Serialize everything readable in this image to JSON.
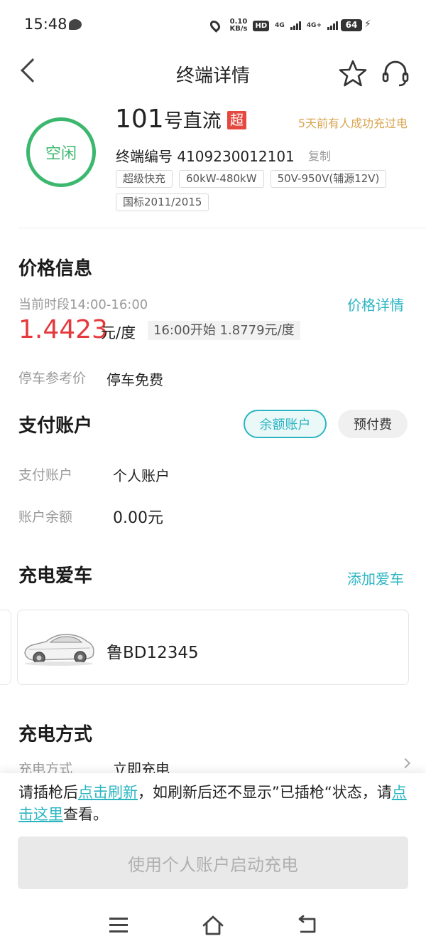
{
  "status_bar": {
    "time": "15:48",
    "speed_value": "0.10",
    "speed_unit": "KB/s",
    "hd_label": "HD",
    "net1": "4G",
    "net2": "4G+",
    "battery": "64"
  },
  "header": {
    "title": "终端详情"
  },
  "terminal": {
    "status": "空闲",
    "name_number": "101",
    "name_suffix": "号直流",
    "super_badge": "超",
    "last_charge_note": "5天前有人成功充过电",
    "terminal_no_label": "终端编号 4109230012101",
    "copy_label": "复制",
    "tags": [
      "超级快充",
      "60kW-480kW",
      "50V-950V(辅源12V)",
      "国标2011/2015"
    ]
  },
  "price": {
    "section_title": "价格信息",
    "detail_link": "价格详情",
    "current_period": "当前时段14:00-16:00",
    "current_price": "1.4423",
    "unit": "元/度",
    "next_price": "16:00开始  1.8779元/度",
    "parking_label": "停车参考价",
    "parking_value": "停车免费"
  },
  "payment": {
    "section_title": "支付账户",
    "balance_account_btn": "余额账户",
    "prepaid_btn": "预付费",
    "account_label": "支付账户",
    "account_value": "个人账户",
    "balance_label": "账户余额",
    "balance_value": "0.00元"
  },
  "car": {
    "section_title": "充电爱车",
    "add_link": "添加爱车",
    "plate": "鲁BD12345"
  },
  "charge_method": {
    "section_title": "充电方式",
    "label": "充电方式",
    "value": "立即充电"
  },
  "notice": {
    "part1": "请插枪后",
    "link1": "点击刷新",
    "part2": "，如刷新后还不显示”已插枪“状态，请",
    "link2": "点击这里",
    "part3": "查看。"
  },
  "start_button": "使用个人账户启动充电",
  "colors": {
    "accent": "#2bb5c2",
    "idle_green": "#3cb86e",
    "price_red": "#e5393c",
    "note_gold": "#d9a550"
  }
}
